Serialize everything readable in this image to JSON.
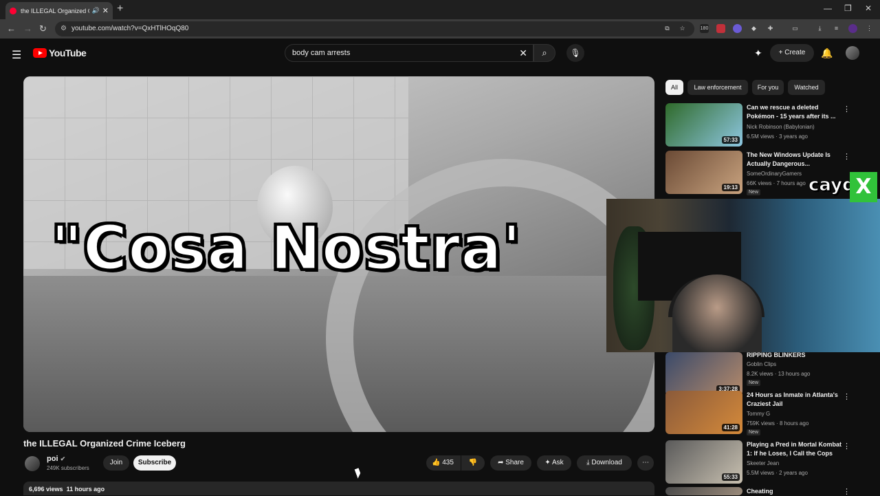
{
  "browser": {
    "tab_title": "the ILLEGAL Organized Crime Iceberg",
    "url": "youtube.com/watch?v=QxHTlHOqQ80",
    "ext_badge": "180"
  },
  "youtube": {
    "logo_text": "YouTube",
    "search_value": "body cam arrests",
    "create_label": "Create"
  },
  "video": {
    "overlay_text": "\"Cosa Nostra'",
    "title": "the ILLEGAL Organized Crime Iceberg",
    "channel": "poi",
    "subscribers": "249K subscribers",
    "join_label": "Join",
    "subscribe_label": "Subscribe",
    "likes": "435",
    "share_label": "Share",
    "ask_label": "Ask",
    "download_label": "Download",
    "views": "6,696 views",
    "age": "11 hours ago"
  },
  "chips": [
    "All",
    "Law enforcement",
    "For you",
    "Watched"
  ],
  "recommendations": [
    {
      "title": "Can we rescue a deleted Pokémon - 15 years after its ...",
      "channel": "Nick Robinson (Babylonian)",
      "meta": "6.5M views · 3 years ago",
      "duration": "57:33",
      "badge": "",
      "thumb": "#2f6a2a"
    },
    {
      "title": "The New Windows Update Is Actually Dangerous...",
      "channel": "SomeOrdinaryGamers",
      "meta": "66K views · 7 hours ago",
      "duration": "19:13",
      "badge": "New",
      "thumb": "#6a4a35"
    },
    {
      "title": "RIPPING BLINKERS",
      "channel": "Goblin Clips",
      "meta": "8.2K views · 13 hours ago",
      "duration": "3:37:28",
      "badge": "New",
      "thumb": "#3a4a6a"
    },
    {
      "title": "24 Hours as Inmate in Atlanta's Craziest Jail",
      "channel": "Tommy G",
      "meta": "759K views · 8 hours ago",
      "duration": "41:28",
      "badge": "New",
      "thumb": "#8a5a3a"
    },
    {
      "title": "Playing a Pred in Mortal Kombat 1: If he Loses, I Call the Cops",
      "channel": "Skeeter Jean",
      "meta": "5.5M views · 2 years ago",
      "duration": "55:33",
      "badge": "",
      "thumb": "#5a5a5a"
    },
    {
      "title": "Cheating",
      "channel": "",
      "meta": "",
      "duration": "",
      "badge": "",
      "thumb": "#4a4a4a"
    }
  ],
  "streamer_overlay": {
    "name": "caydr",
    "mark": "X"
  }
}
